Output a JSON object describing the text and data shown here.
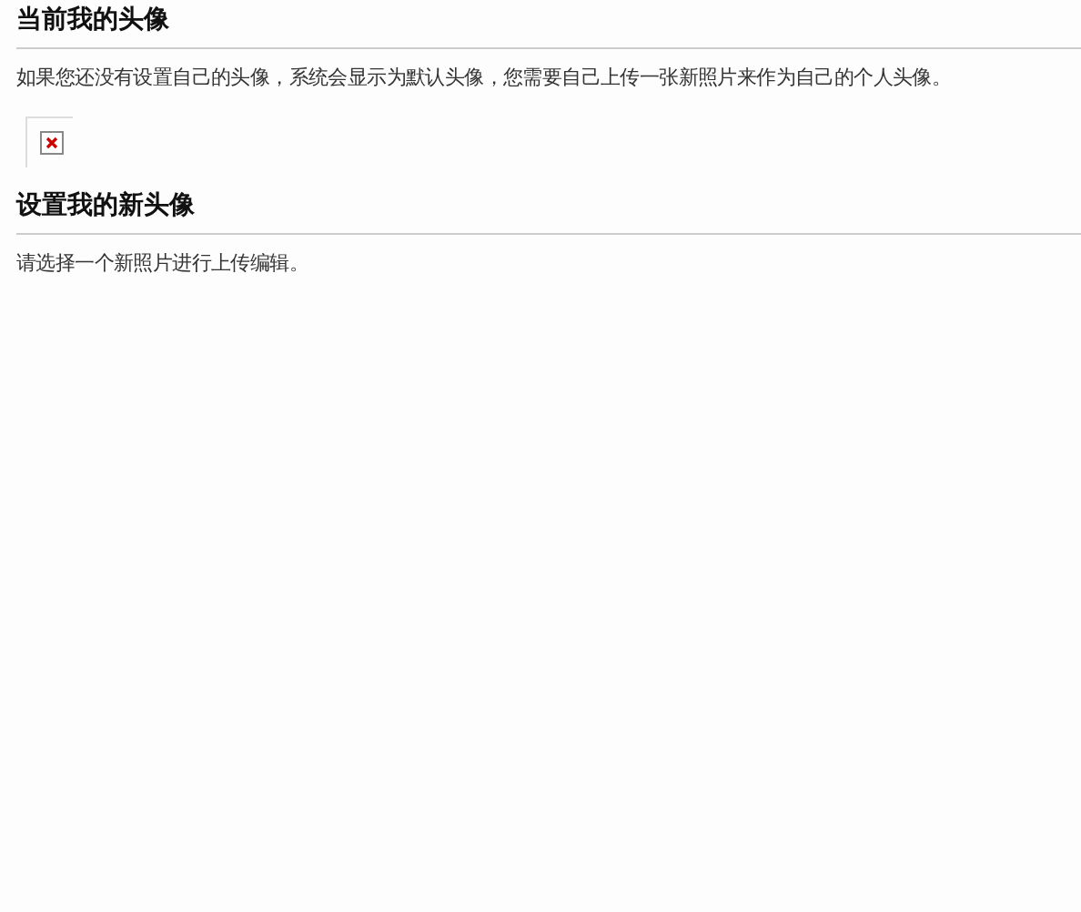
{
  "current_avatar": {
    "title": "当前我的头像",
    "description": "如果您还没有设置自己的头像，系统会显示为默认头像，您需要自己上传一张新照片来作为自己的个人头像。"
  },
  "new_avatar": {
    "title": "设置我的新头像",
    "instruction": "请选择一个新照片进行上传编辑。"
  }
}
